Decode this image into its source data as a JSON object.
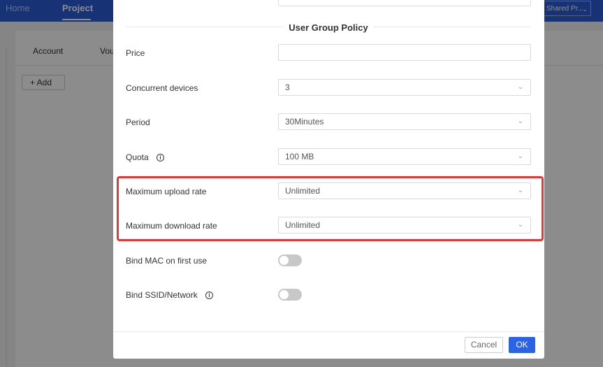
{
  "app": {
    "nav": {
      "home": "Home",
      "project": "Project"
    },
    "shared_select": "Shared Pr...",
    "tabs": {
      "account": "Account",
      "voucher": "Vou"
    },
    "add_button": "+ Add"
  },
  "modal": {
    "section_title": "User Group Policy",
    "price": {
      "label": "Price",
      "value": ""
    },
    "concurrent": {
      "label": "Concurrent devices",
      "value": "3"
    },
    "period": {
      "label": "Period",
      "value": "30Minutes"
    },
    "quota": {
      "label": "Quota",
      "value": "100 MB"
    },
    "upload": {
      "label": "Maximum upload rate",
      "value": "Unlimited"
    },
    "download": {
      "label": "Maximum download rate",
      "value": "Unlimited"
    },
    "bind_mac": {
      "label": "Bind MAC on first use",
      "enabled": false
    },
    "bind_ssid": {
      "label": "Bind SSID/Network",
      "enabled": false
    },
    "cancel": "Cancel",
    "ok": "OK"
  },
  "icons": {
    "info": "info-circle-icon",
    "chevron": "chevron-down-icon"
  },
  "colors": {
    "primary": "#2b62e6",
    "header": "#2b5cd6",
    "highlight": "#e53935"
  }
}
